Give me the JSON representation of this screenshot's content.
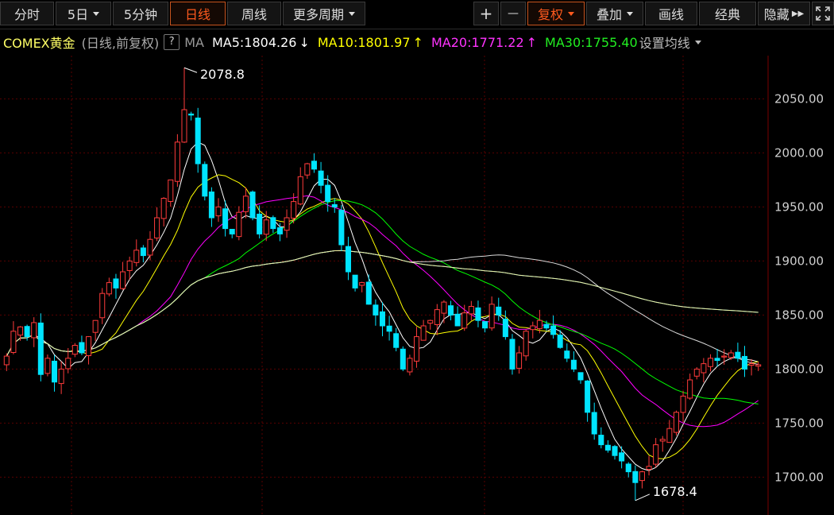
{
  "toolbar": {
    "tabs": [
      {
        "label": "分时"
      },
      {
        "label": "5日"
      },
      {
        "label": "5分钟"
      },
      {
        "label": "日线"
      },
      {
        "label": "周线"
      },
      {
        "label": "更多周期"
      },
      {
        "label": "+"
      },
      {
        "label": "—"
      },
      {
        "label": "复权"
      },
      {
        "label": "叠加"
      },
      {
        "label": "画线"
      },
      {
        "label": "经典"
      },
      {
        "label": "隐藏"
      }
    ],
    "active_tab": "日线"
  },
  "info": {
    "symbol": "COMEX黄金",
    "mode": "(日线,前复权)",
    "help": "?",
    "ma_label": "MA",
    "ma5": "MA5:1804.26",
    "ma10": "MA10:1801.97",
    "ma20": "MA20:1771.22",
    "ma30": "MA30:1755.40",
    "settings": "设置均线",
    "colors": {
      "ma5": "#ffffff",
      "ma10": "#ffff00",
      "ma20": "#ff00ff",
      "ma30": "#00ff00"
    }
  },
  "chart_data": {
    "type": "candlestick",
    "ylim": [
      1665,
      2090
    ],
    "yticks": [
      "2050.00",
      "2000.00",
      "1950.00",
      "1900.00",
      "1850.00",
      "1800.00",
      "1750.00",
      "1700.00"
    ],
    "y_tick_values": [
      2050,
      2000,
      1950,
      1900,
      1850,
      1800,
      1750,
      1700
    ],
    "annotations": [
      {
        "text": "2078.8",
        "value": 2078.8
      },
      {
        "text": "1678.4",
        "value": 1678.4
      }
    ],
    "colors": {
      "up": "#ff3b3b",
      "down": "#00e4ff",
      "grid": "#5a0000",
      "ma5": "#ffffff",
      "ma10": "#ffff00",
      "ma20": "#ff00ff",
      "ma30": "#00ff00",
      "ma60": "#d8d8d8",
      "ma120": "#55d8ff",
      "ma250": "#f0f0a0"
    },
    "closes": [
      1812,
      1835,
      1839,
      1830,
      1843,
      1795,
      1810,
      1788,
      1800,
      1810,
      1822,
      1815,
      1830,
      1845,
      1870,
      1880,
      1875,
      1890,
      1900,
      1910,
      1905,
      1920,
      1940,
      1958,
      1975,
      2010,
      2040,
      2035,
      1990,
      1960,
      1940,
      1950,
      1930,
      1925,
      1945,
      1960,
      1940,
      1925,
      1938,
      1930,
      1925,
      1940,
      1955,
      1978,
      1990,
      1985,
      1970,
      1955,
      1950,
      1915,
      1890,
      1875,
      1880,
      1860,
      1850,
      1840,
      1835,
      1820,
      1800,
      1810,
      1830,
      1840,
      1845,
      1855,
      1862,
      1850,
      1840,
      1852,
      1858,
      1845,
      1838,
      1860,
      1850,
      1830,
      1800,
      1815,
      1835,
      1840,
      1845,
      1838,
      1832,
      1820,
      1810,
      1800,
      1790,
      1760,
      1740,
      1730,
      1725,
      1720,
      1715,
      1705,
      1695,
      1705,
      1710,
      1730,
      1735,
      1745,
      1760,
      1775,
      1790,
      1800,
      1805,
      1810,
      1808,
      1812,
      1815,
      1810,
      1800,
      1805,
      1804
    ]
  }
}
